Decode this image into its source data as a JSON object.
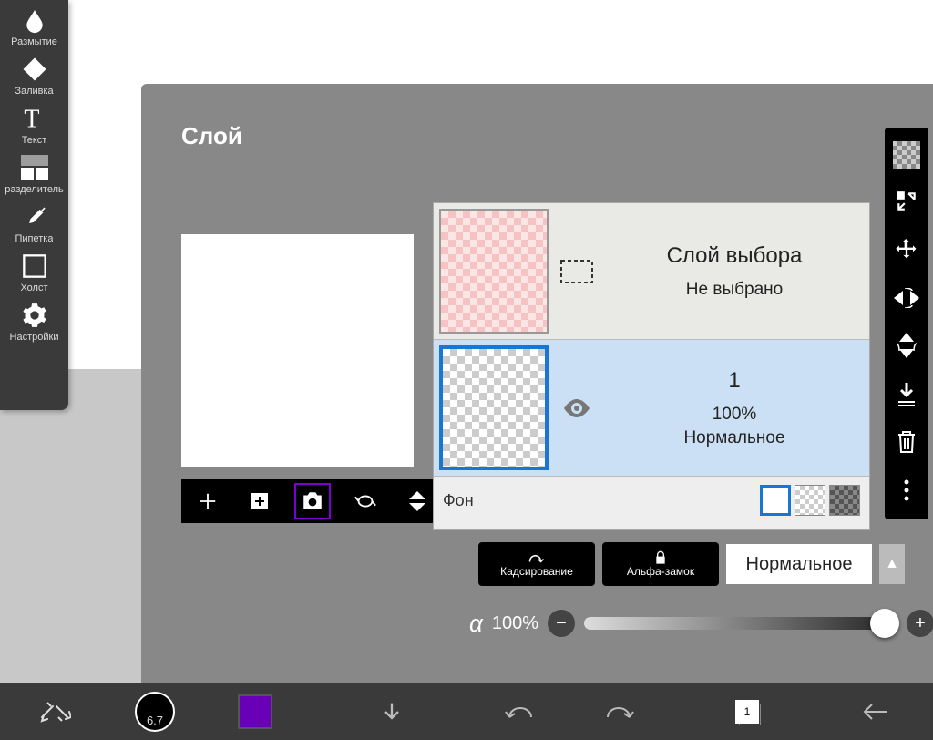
{
  "left_toolbar": {
    "items": [
      {
        "label": "Размытие",
        "icon": "blur"
      },
      {
        "label": "Заливка",
        "icon": "bucket"
      },
      {
        "label": "Текст",
        "icon": "text"
      },
      {
        "label": "разделитель",
        "icon": "divider"
      },
      {
        "label": "Пипетка",
        "icon": "eyedropper"
      },
      {
        "label": "Холст",
        "icon": "canvas"
      },
      {
        "label": "Настройки",
        "icon": "settings"
      }
    ]
  },
  "panel": {
    "title": "Слой"
  },
  "action_bar": [
    "add",
    "new-image",
    "camera",
    "mirror-h",
    "mirror-v"
  ],
  "layers": {
    "selection": {
      "title": "Слой выбора",
      "status": "Не выбрано"
    },
    "active": {
      "name": "1",
      "opacity": "100%",
      "blend": "Нормальное"
    },
    "bg_label": "Фон"
  },
  "bottom_controls": {
    "cropping": "Кадсирование",
    "alpha_lock": "Альфа-замок",
    "blend_mode": "Нормальное"
  },
  "slider": {
    "alpha_symbol": "α",
    "value": "100%"
  },
  "bottom_bar": {
    "brush_size": "6.7",
    "layer_count": "1"
  }
}
